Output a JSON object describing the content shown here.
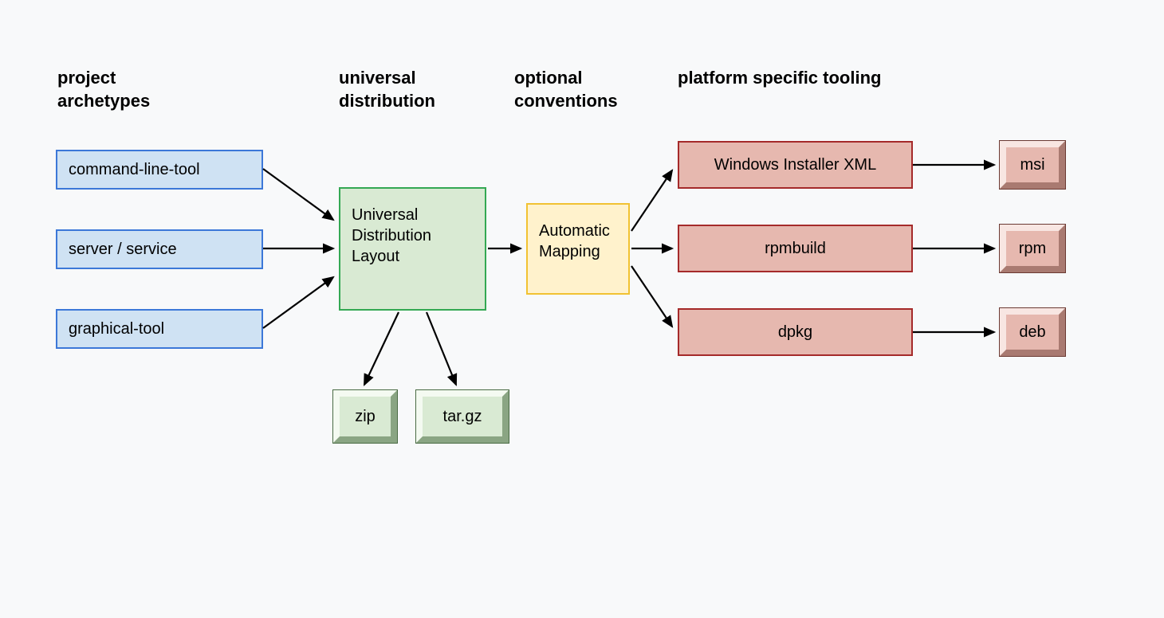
{
  "headings": {
    "archetypes": "project\narchetypes",
    "distribution": "universal\ndistribution",
    "conventions": "optional\nconventions",
    "tooling": "platform specific tooling"
  },
  "archetypes": {
    "cli": "command-line-tool",
    "server": "server / service",
    "gui": "graphical-tool"
  },
  "distribution": {
    "layout": "Universal Distribution Layout",
    "zip": "zip",
    "targz": "tar.gz"
  },
  "conventions": {
    "mapping": "Automatic Mapping"
  },
  "tooling": {
    "wix": "Windows Installer XML",
    "rpmbuild": "rpmbuild",
    "dpkg": "dpkg",
    "msi": "msi",
    "rpm": "rpm",
    "deb": "deb"
  }
}
